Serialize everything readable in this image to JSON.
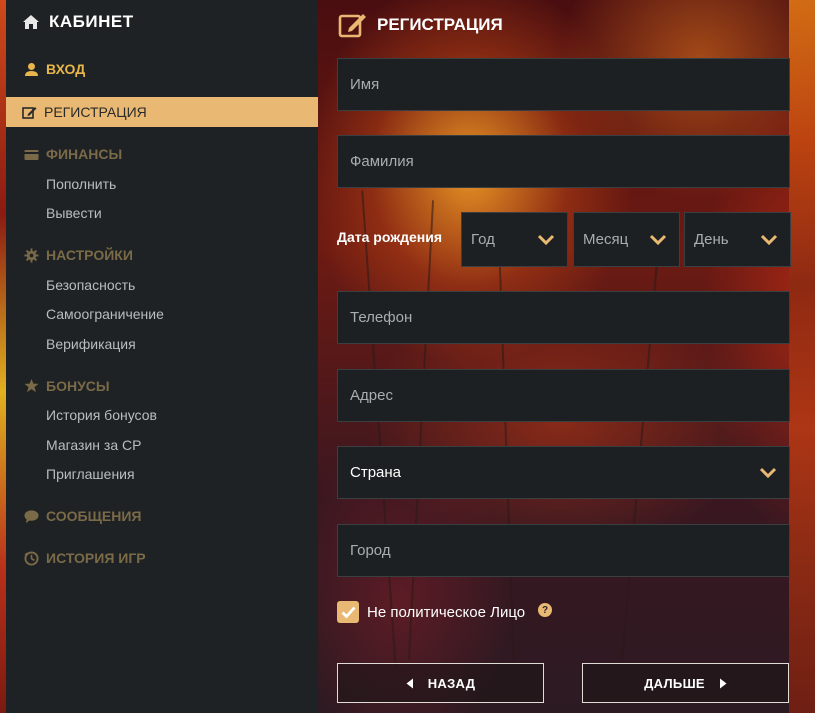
{
  "sidebar": {
    "title": "КАБИНЕТ",
    "login": "ВХОД",
    "active_item": "РЕГИСТРАЦИЯ",
    "sections": [
      {
        "label": "ФИНАНСЫ",
        "items": [
          "Пополнить",
          "Вывести"
        ]
      },
      {
        "label": "НАСТРОЙКИ",
        "items": [
          "Безопасность",
          "Самоограничение",
          "Верификация"
        ]
      },
      {
        "label": "БОНУСЫ",
        "items": [
          "История бонусов",
          "Магазин за CP",
          "Приглашения"
        ]
      },
      {
        "label": "СООБЩЕНИЯ",
        "items": []
      },
      {
        "label": "ИСТОРИЯ ИГР",
        "items": []
      }
    ]
  },
  "form": {
    "title": "РЕГИСТРАЦИЯ",
    "first_name_placeholder": "Имя",
    "last_name_placeholder": "Фамилия",
    "dob_label": "Дата рождения",
    "dob_year": "Год",
    "dob_month": "Месяц",
    "dob_day": "День",
    "phone_placeholder": "Телефон",
    "address_placeholder": "Адрес",
    "country": "Страна",
    "city_placeholder": "Город",
    "pep_label": "Не политическое Лицо",
    "pep_checked": true,
    "back_button": "НАЗАД",
    "next_button": "ДАЛЬШЕ"
  },
  "colors": {
    "accent": "#e9b872",
    "sidebar_bg": "#1e2224",
    "field_bg": "#1c2022",
    "section_muted": "#7a6a48"
  },
  "icons": {
    "cabinet": "home-icon",
    "login": "user-icon",
    "registration": "edit-icon",
    "finances": "wallet-icon",
    "settings": "gear-icon",
    "bonuses": "star-icon",
    "messages": "chat-icon",
    "history": "history-icon",
    "select": "chevron-down-icon",
    "help": "question-icon"
  }
}
